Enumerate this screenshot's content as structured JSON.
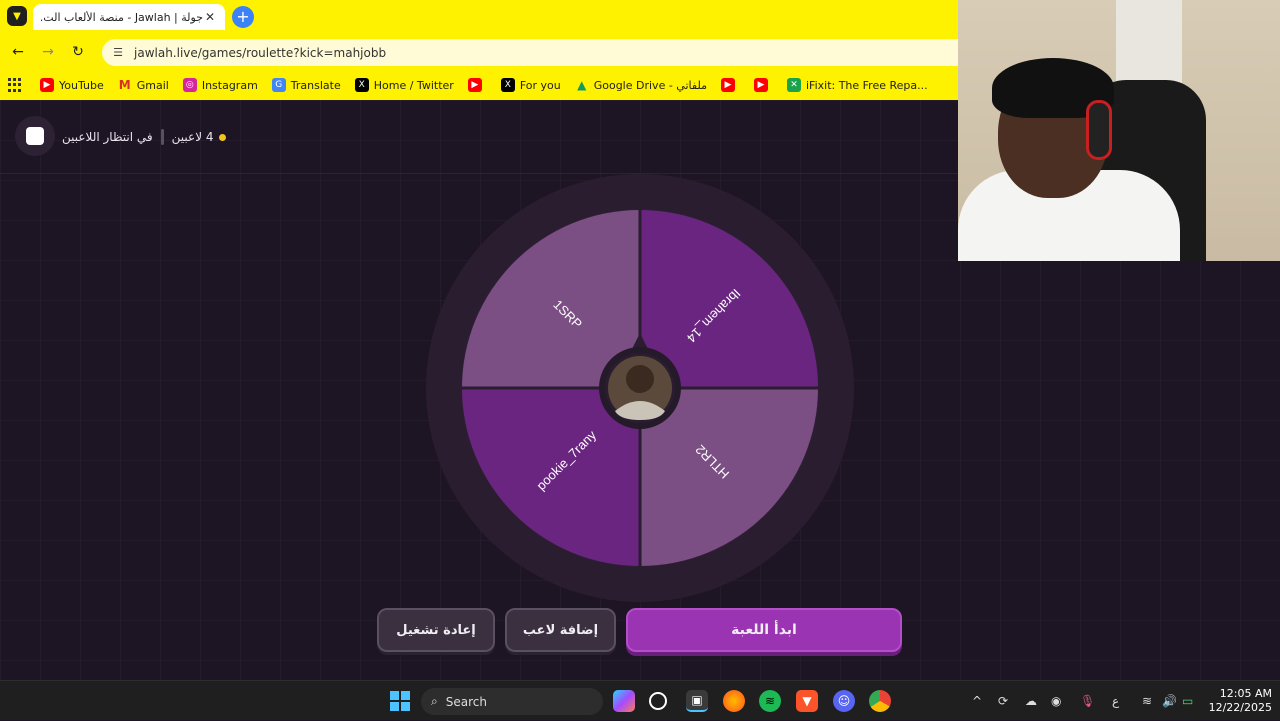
{
  "browser": {
    "tab_title": "جولة | Jawlah - منصة الألعاب الت...",
    "new_tab_label": "+",
    "url": "jawlah.live/games/roulette?kick=mahjobb",
    "bookmarks": [
      {
        "icon": "youtube-icon",
        "label": "YouTube"
      },
      {
        "icon": "gmail-icon",
        "label": "Gmail"
      },
      {
        "icon": "instagram-icon",
        "label": "Instagram"
      },
      {
        "icon": "translate-icon",
        "label": "Translate"
      },
      {
        "icon": "x-icon",
        "label": "Home / Twitter"
      },
      {
        "icon": "youtube-icon",
        "label": ""
      },
      {
        "icon": "x-icon",
        "label": "For you"
      },
      {
        "icon": "google-drive-icon",
        "label": "Google Drive - ملفاتي"
      },
      {
        "icon": "youtube-icon",
        "label": ""
      },
      {
        "icon": "youtube-icon",
        "label": ""
      },
      {
        "icon": "ifixit-icon",
        "label": "iFixit: The Free Repa..."
      }
    ]
  },
  "game": {
    "status_waiting": "في انتظار اللاعبين",
    "player_count": "4 لاعبين",
    "players": [
      "Ibrahem_14",
      "HTLR2",
      "pookie_7rany",
      "1SRP"
    ],
    "buttons": {
      "start": "ابدأ اللعبة",
      "add_player": "إضافة لاعب",
      "restart": "إعادة تشغيل"
    }
  },
  "colors": {
    "segment_dark": "#6a2580",
    "segment_light": "#7b4e84",
    "accent": "#9b34b3"
  },
  "taskbar": {
    "search_label": "Search",
    "time": "12:05 AM",
    "date": "12/22/2025",
    "lang": "ع"
  }
}
